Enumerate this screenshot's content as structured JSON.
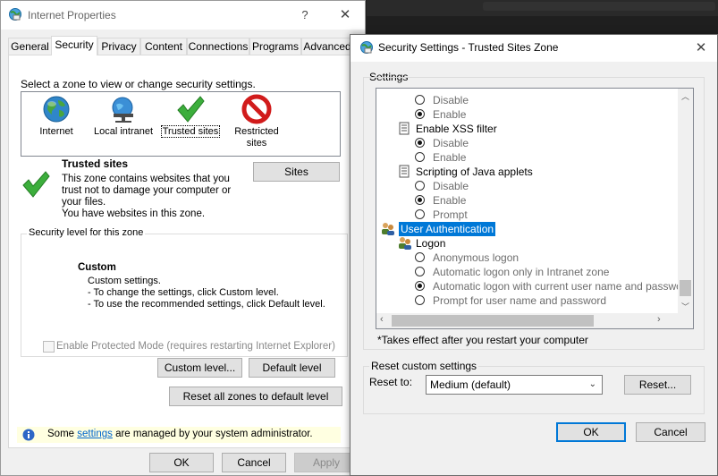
{
  "props_window": {
    "title": "Internet Properties",
    "help_glyph": "?",
    "close_glyph": "✕",
    "tabs": [
      {
        "label": "General"
      },
      {
        "label": "Security"
      },
      {
        "label": "Privacy"
      },
      {
        "label": "Content"
      },
      {
        "label": "Connections"
      },
      {
        "label": "Programs"
      },
      {
        "label": "Advanced"
      }
    ],
    "zone_prompt": "Select a zone to view or change security settings.",
    "zones": [
      {
        "label_1": "Internet",
        "label_2": "",
        "icon": "globe-icon"
      },
      {
        "label_1": "Local intranet",
        "label_2": "",
        "icon": "intranet-icon"
      },
      {
        "label_1": "Trusted sites",
        "label_2": "",
        "icon": "checkmark-icon"
      },
      {
        "label_1": "Restricted",
        "label_2": "sites",
        "icon": "restricted-icon"
      }
    ],
    "zone_title": "Trusted sites",
    "zone_desc_1": "This zone contains websites that you",
    "zone_desc_2": "trust not to damage your computer or",
    "zone_desc_3": "your files.",
    "zone_desc_4": "You have websites in this zone.",
    "sites_button": "Sites",
    "security_level_title": "Security level for this zone",
    "level_name": "Custom",
    "level_desc_1": "Custom settings.",
    "level_desc_2": "- To change the settings, click Custom level.",
    "level_desc_3": "- To use the recommended settings, click Default level.",
    "protected_mode_label": "Enable Protected Mode (requires restarting Internet Explorer)",
    "custom_level_button": "Custom level...",
    "default_level_button": "Default level",
    "reset_all_button": "Reset all zones to default level",
    "info_prefix": "Some ",
    "info_link": "settings",
    "info_suffix": " are managed by your system administrator.",
    "ok_button": "OK",
    "cancel_button": "Cancel",
    "apply_button": "Apply"
  },
  "settings_window": {
    "title": "Security Settings - Trusted Sites Zone",
    "close_glyph": "✕",
    "settings_label": "Settings",
    "items": [
      {
        "type": "radio",
        "label": "Disable",
        "checked": false
      },
      {
        "type": "radio",
        "label": "Enable",
        "checked": true
      },
      {
        "type": "header",
        "label": "Enable XSS filter"
      },
      {
        "type": "radio",
        "label": "Disable",
        "checked": true
      },
      {
        "type": "radio",
        "label": "Enable",
        "checked": false
      },
      {
        "type": "header",
        "label": "Scripting of Java applets"
      },
      {
        "type": "radio",
        "label": "Disable",
        "checked": false
      },
      {
        "type": "radio",
        "label": "Enable",
        "checked": true
      },
      {
        "type": "radio",
        "label": "Prompt",
        "checked": false
      },
      {
        "type": "category",
        "label": "User Authentication"
      },
      {
        "type": "subheader",
        "label": "Logon"
      },
      {
        "type": "radio",
        "label": "Anonymous logon",
        "checked": false
      },
      {
        "type": "radio",
        "label": "Automatic logon only in Intranet zone",
        "checked": false
      },
      {
        "type": "radio",
        "label": "Automatic logon with current user name and password",
        "checked": true
      },
      {
        "type": "radio",
        "label": "Prompt for user name and password",
        "checked": false
      }
    ],
    "takes_effect_note": "*Takes effect after you restart your computer",
    "reset_group_title": "Reset custom settings",
    "reset_to_label": "Reset to:",
    "reset_to_value": "Medium (default)",
    "reset_button": "Reset...",
    "ok_button": "OK",
    "cancel_button": "Cancel"
  }
}
